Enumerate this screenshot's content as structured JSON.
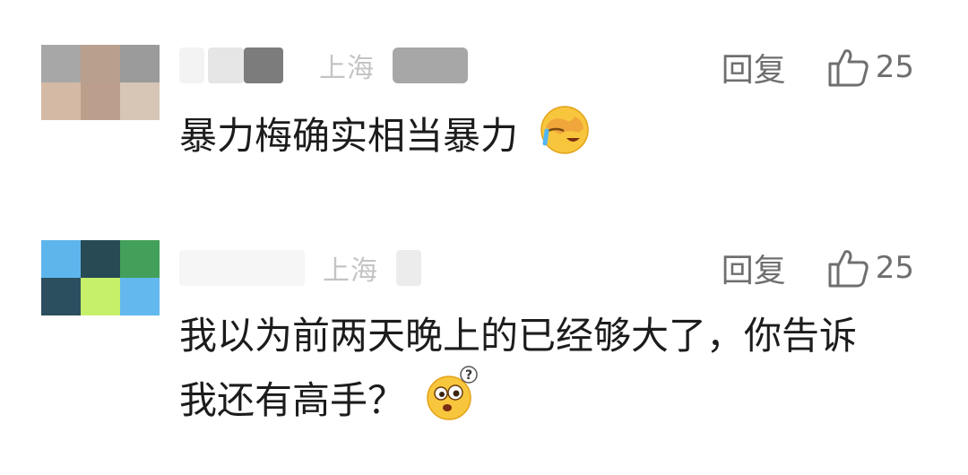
{
  "comments": [
    {
      "location": "上海",
      "reply_label": "回复",
      "like_count": "25",
      "text": "暴力梅确实相当暴力",
      "emoji": "face-palm-laughing-emoji",
      "avatar_colors": [
        "#a7a7a7",
        "#b99f8d",
        "#9b9b9b",
        "#d4b9a4",
        "#bb9f8c",
        "#d7c6b6"
      ]
    },
    {
      "location": "上海",
      "reply_label": "回复",
      "like_count": "25",
      "text_line1": "我以为前两天晚上的已经够大了，你告诉",
      "text_line2": "我还有高手？",
      "emoji": "surprised-question-emoji",
      "avatar_colors": [
        "#5db5ec",
        "#274a55",
        "#43a05b",
        "#2b4f5e",
        "#c7f06a",
        "#63b8ee"
      ]
    }
  ]
}
